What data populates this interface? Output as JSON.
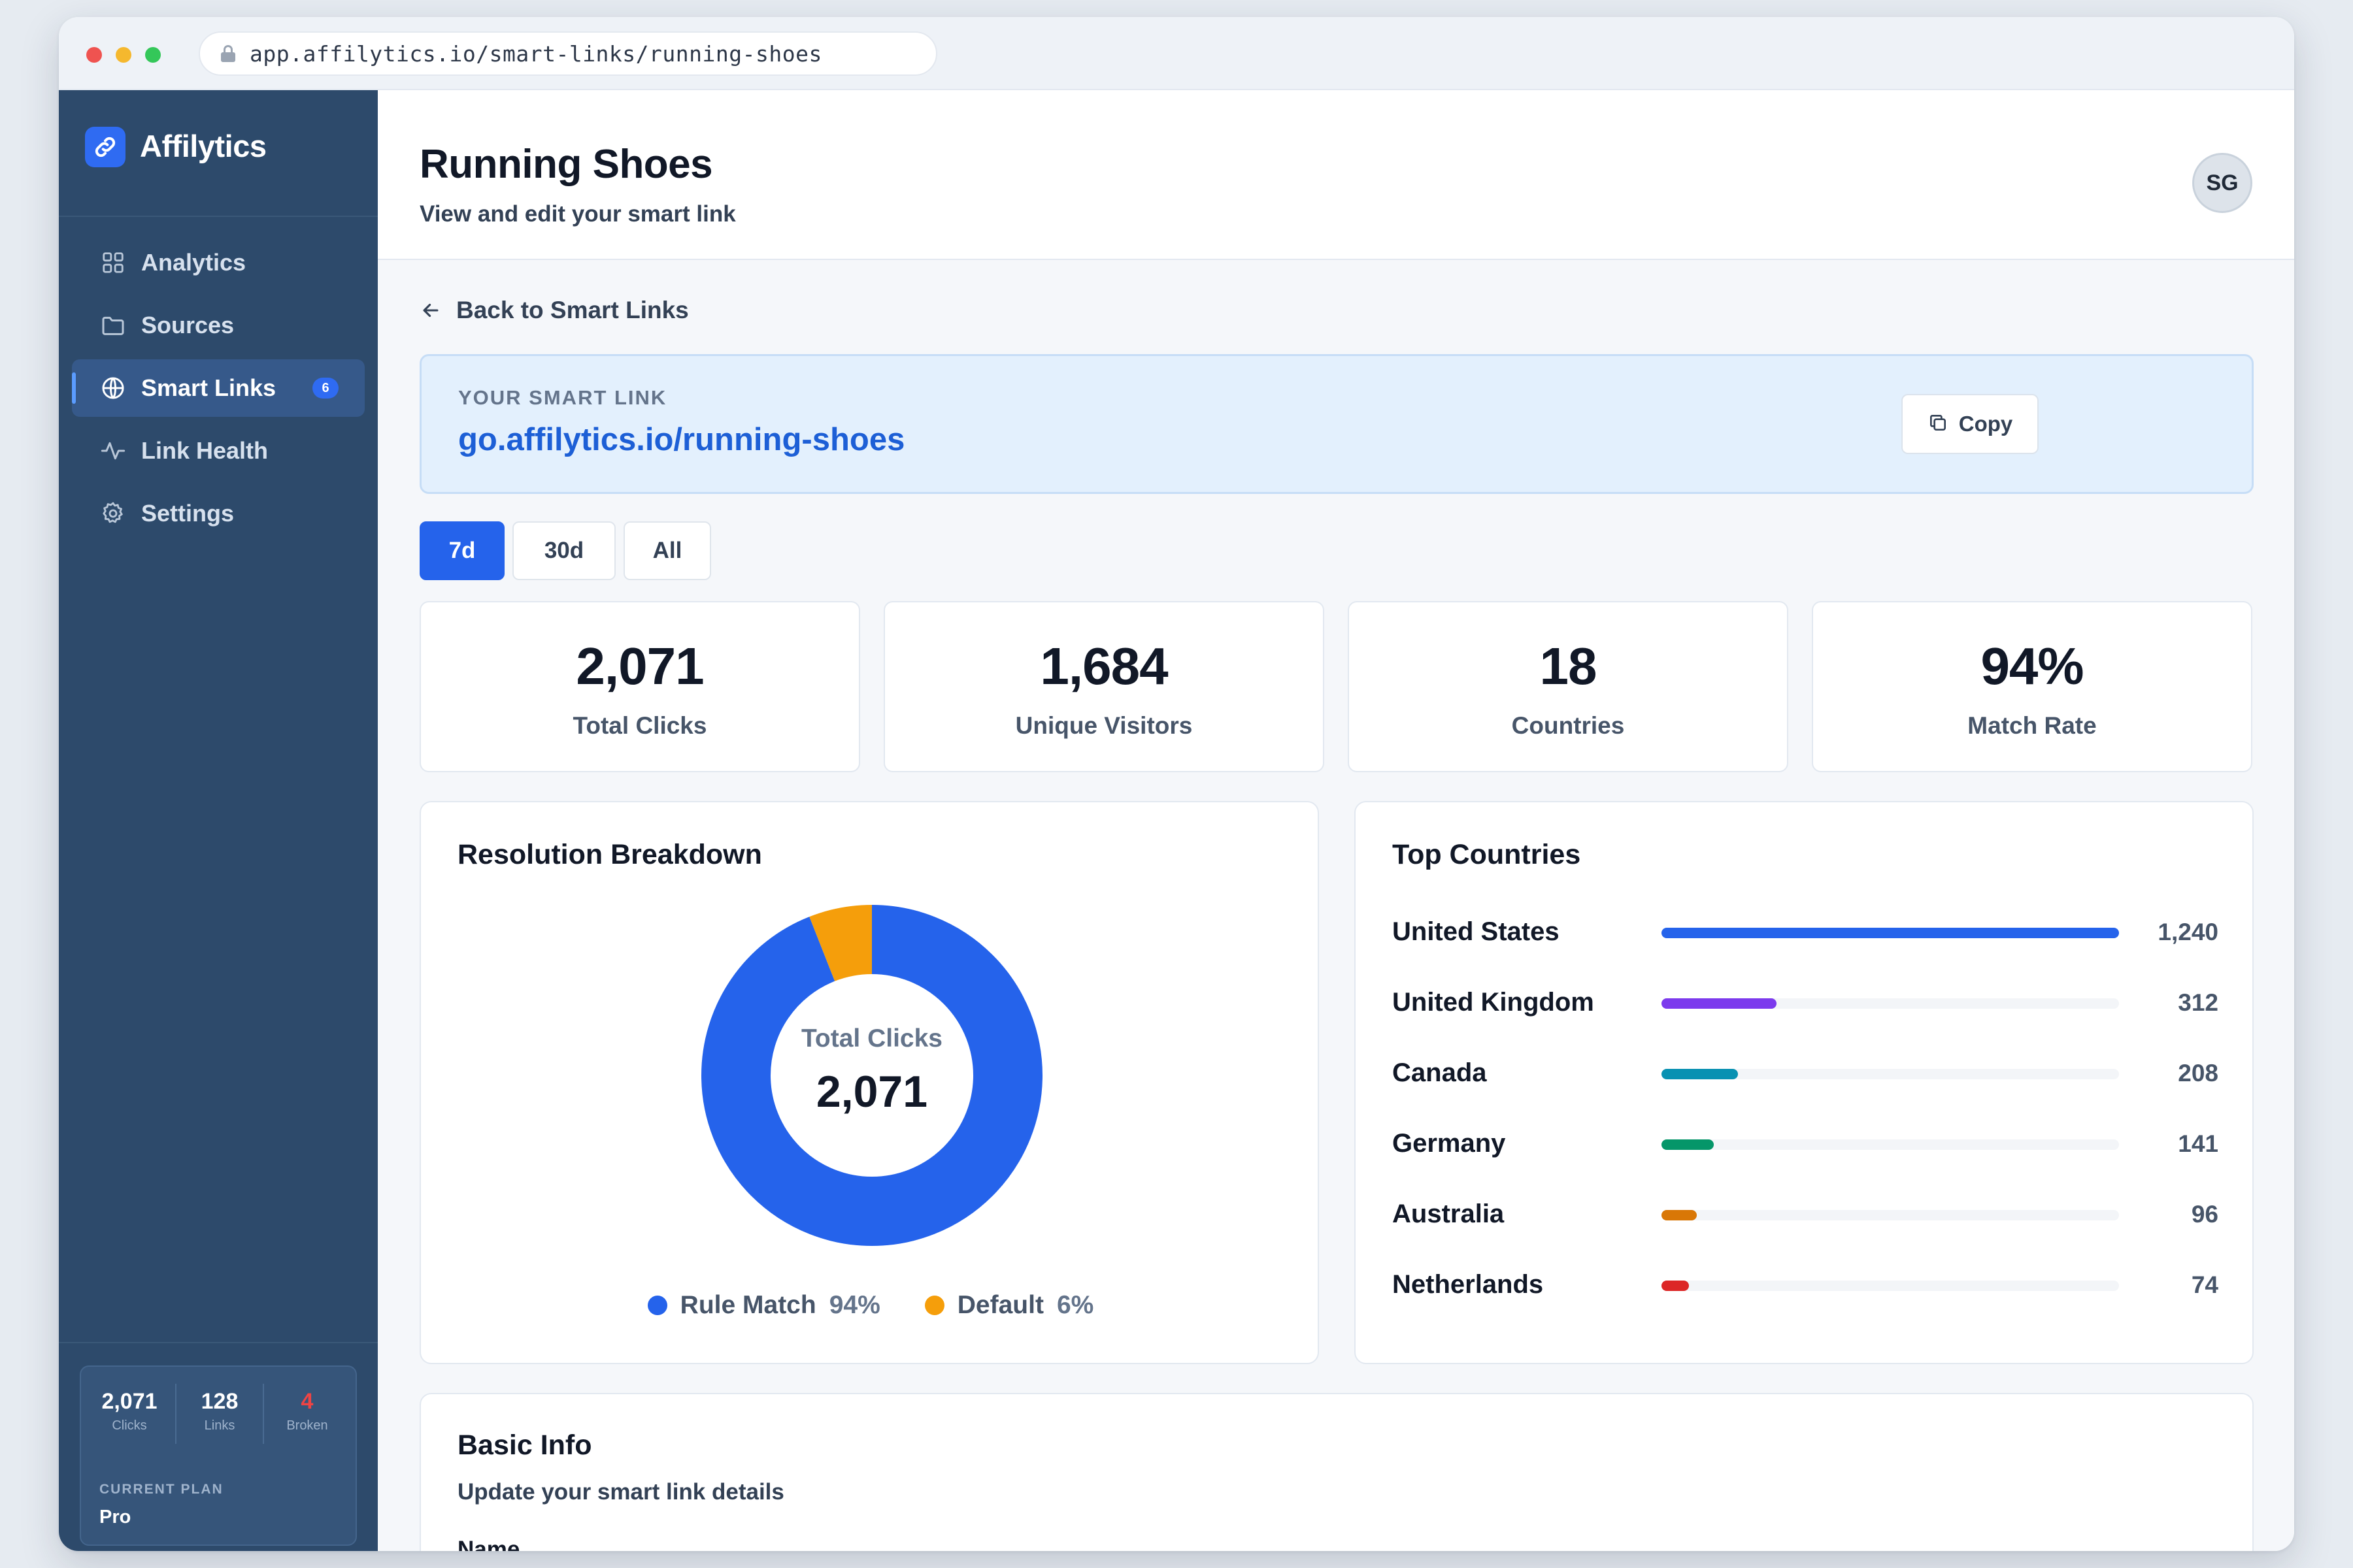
{
  "browser": {
    "url": "app.affilytics.io/smart-links/running-shoes"
  },
  "sidebar": {
    "brand": "Affilytics",
    "items": [
      {
        "label": "Analytics",
        "icon": "grid-icon"
      },
      {
        "label": "Sources",
        "icon": "folder-icon"
      },
      {
        "label": "Smart Links",
        "icon": "globe-icon",
        "badge": "6",
        "active": true
      },
      {
        "label": "Link Health",
        "icon": "activity-icon"
      },
      {
        "label": "Settings",
        "icon": "gear-icon"
      }
    ],
    "stats": {
      "clicks_value": "2,071",
      "clicks_label": "Clicks",
      "links_value": "128",
      "links_label": "Links",
      "broken_value": "4",
      "broken_label": "Broken"
    },
    "plan_label": "CURRENT PLAN",
    "plan_value": "Pro"
  },
  "header": {
    "title": "Running Shoes",
    "subtitle": "View and edit your smart link",
    "avatar_initials": "SG"
  },
  "back_link": "Back to Smart Links",
  "smart_link": {
    "label": "YOUR SMART LINK",
    "url": "go.affilytics.io/running-shoes",
    "copy_label": "Copy"
  },
  "ranges": [
    {
      "label": "7d",
      "active": true
    },
    {
      "label": "30d",
      "active": false
    },
    {
      "label": "All",
      "active": false
    }
  ],
  "stats": [
    {
      "value": "2,071",
      "label": "Total Clicks"
    },
    {
      "value": "1,684",
      "label": "Unique Visitors"
    },
    {
      "value": "18",
      "label": "Countries"
    },
    {
      "value": "94%",
      "label": "Match Rate"
    }
  ],
  "resolution": {
    "title": "Resolution Breakdown",
    "center_label": "Total Clicks",
    "center_value": "2,071",
    "legend": [
      {
        "name": "Rule Match",
        "pct": "94%",
        "color": "#2563eb"
      },
      {
        "name": "Default",
        "pct": "6%",
        "color": "#f59e0b"
      }
    ]
  },
  "top_countries": {
    "title": "Top Countries"
  },
  "chart_data": [
    {
      "type": "pie",
      "title": "Resolution Breakdown",
      "categories": [
        "Rule Match",
        "Default"
      ],
      "values": [
        94,
        6
      ],
      "colors": [
        "#2563eb",
        "#f59e0b"
      ]
    },
    {
      "type": "bar",
      "title": "Top Countries",
      "categories": [
        "United States",
        "United Kingdom",
        "Canada",
        "Germany",
        "Australia",
        "Netherlands"
      ],
      "values": [
        1240,
        312,
        208,
        141,
        96,
        74
      ],
      "value_labels": [
        "1,240",
        "312",
        "208",
        "141",
        "96",
        "74"
      ],
      "colors": [
        "#2563eb",
        "#7c3aed",
        "#0891b2",
        "#059669",
        "#d97706",
        "#dc2626"
      ]
    }
  ],
  "basic_info": {
    "title": "Basic Info",
    "subtitle": "Update your smart link details",
    "name_label": "Name"
  }
}
